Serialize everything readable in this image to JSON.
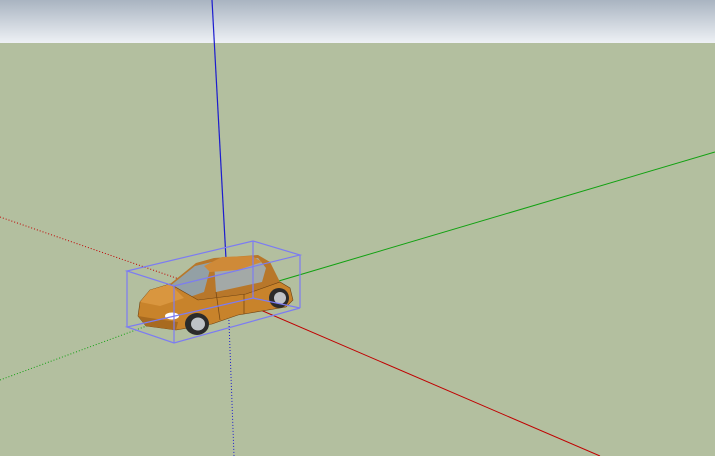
{
  "scene": {
    "sky_color_top": "#a9b4c1",
    "sky_color_bottom": "#eef1f5",
    "ground_color": "#b3bf9f",
    "axis_colors": {
      "red": "#c00000",
      "green": "#11a111",
      "blue": "#1c1ccf"
    },
    "model": {
      "name": "car",
      "body_color": "#c8832b",
      "selected": true,
      "selection_color": "#7c7cf2"
    }
  }
}
